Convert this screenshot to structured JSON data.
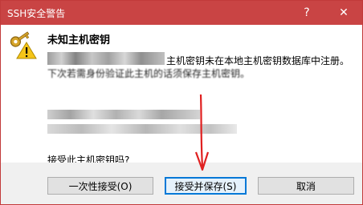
{
  "window": {
    "title": "SSH安全警告"
  },
  "titlebar": {
    "help_glyph": "?",
    "close_glyph": "✕"
  },
  "dialog": {
    "heading": "未知主机密钥",
    "message_line1": "主机密钥未在本地主机密钥数据库中注册。",
    "message_line2": "下次若需身份验证此主机的话须保存主机密钥。",
    "question": "接受此主机密钥吗?",
    "icon": "warning-key-icon"
  },
  "buttons": {
    "accept_once": "一次性接受(O)",
    "accept_save": "接受并保存(S)",
    "cancel": "取消"
  },
  "colors": {
    "titlebar": "#c94444",
    "annotation_arrow": "#e02020",
    "default_button_border": "#0078d7"
  }
}
